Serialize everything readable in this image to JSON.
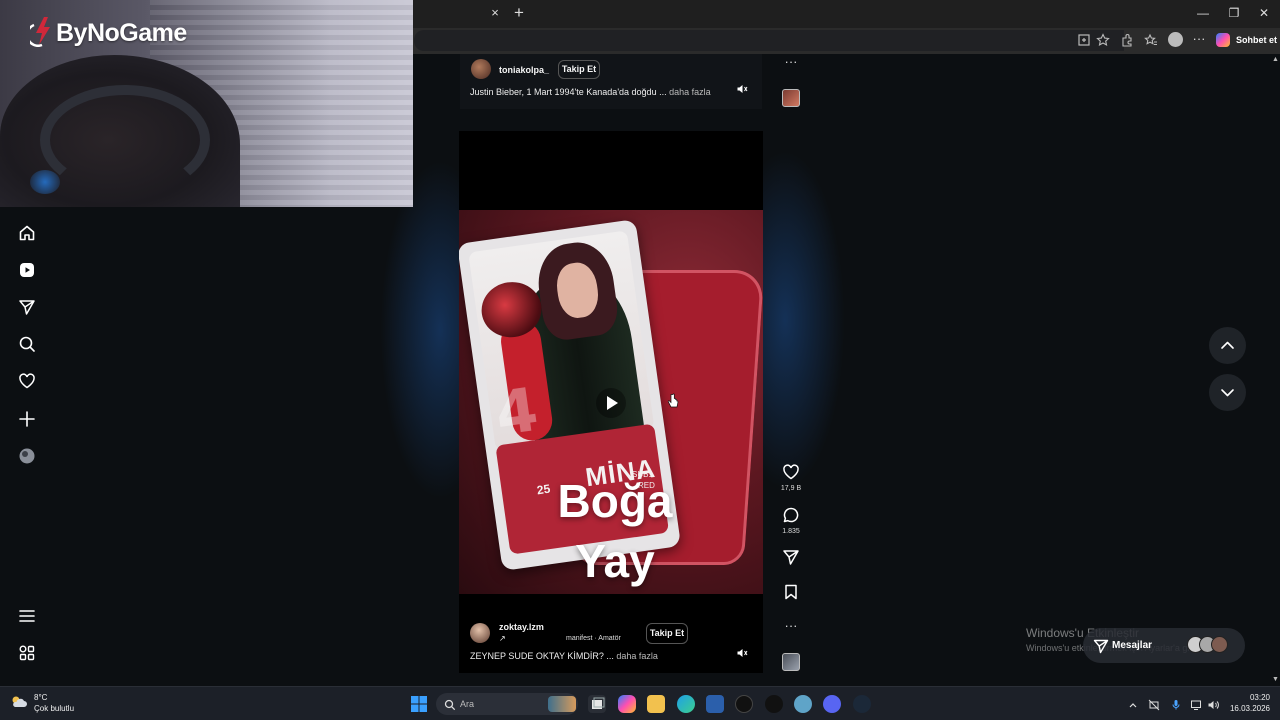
{
  "webcam": {
    "logo_text": "ByNoGame"
  },
  "browser": {
    "copilot_label": "Sohbet et",
    "tab_close": "×",
    "new_tab": "+",
    "more": "···",
    "minimize": "—",
    "restore": "❐",
    "close": "✕"
  },
  "sidebar": {
    "items": [
      "home-icon",
      "reels-icon",
      "send-icon",
      "search-icon",
      "heart-icon",
      "create-icon",
      "profile-icon",
      "menu-icon",
      "apps-icon"
    ]
  },
  "post1": {
    "username": "toniakolpa_",
    "follow_label": "Takip Et",
    "caption": "Justin Bieber, 1 Mart 1994'te Kanada'da doğdu ...",
    "more_label": "daha fazla",
    "more_dots": "···"
  },
  "reel": {
    "card_number": "4",
    "card_rating": "25",
    "card_name": "MİNA",
    "card_sub1": "SUB1",
    "card_sub2": "RED",
    "overlay_line1": "Boğa",
    "overlay_line2": "Yay",
    "likes": "17,9 B",
    "comments": "1.835",
    "more_dots": "···"
  },
  "post2": {
    "username": "zoktay.lzm",
    "arrow": "↗",
    "audio": "manifest · Amatör",
    "follow_label": "Takip Et",
    "caption": "ZEYNEP SUDE OKTAY KİMDİR? ...",
    "more_label": "daha fazla"
  },
  "overlay": {
    "windows_activate": "Windows'u Etkinleştir",
    "windows_activate_sub": "Windows'u etkinleştirmek için Ayarlar'a gidin.",
    "messages_label": "Mesajlar"
  },
  "taskbar": {
    "temperature": "8°C",
    "weather": "Çok bulutlu",
    "search_placeholder": "Ara",
    "time": "03:20",
    "date": "16.03.2026"
  },
  "colors": {
    "background": "#0c0f12",
    "accent_red": "#a51d2d",
    "nav_button": "#1f2328"
  }
}
